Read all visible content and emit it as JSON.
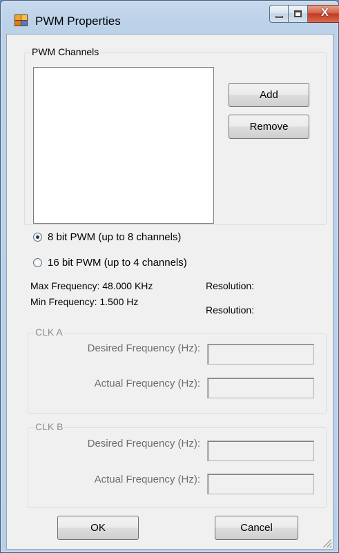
{
  "window": {
    "title": "PWM Properties",
    "close_glyph": "X"
  },
  "channels": {
    "group_label": "PWM Channels",
    "add_label": "Add",
    "remove_label": "Remove",
    "items": []
  },
  "mode": {
    "options": [
      {
        "label": "8 bit PWM (up to 8 channels)",
        "checked": true
      },
      {
        "label": "16 bit PWM (up to 4 channels)",
        "checked": false
      }
    ]
  },
  "info": {
    "max_frequency": "Max Frequency: 48.000 KHz",
    "min_frequency": "Min Frequency: 1.500 Hz",
    "max_resolution": "Resolution:",
    "min_resolution": "Resolution:"
  },
  "clk_a": {
    "group_label": "CLK A",
    "desired_label": "Desired Frequency (Hz):",
    "actual_label": "Actual Frequency (Hz):",
    "desired_value": "",
    "actual_value": ""
  },
  "clk_b": {
    "group_label": "CLK B",
    "desired_label": "Desired Frequency (Hz):",
    "actual_label": "Actual Frequency (Hz):",
    "desired_value": "",
    "actual_value": ""
  },
  "footer": {
    "ok_label": "OK",
    "cancel_label": "Cancel"
  },
  "icons": {
    "app": "app-icon",
    "resize": "resize-grip-icon"
  }
}
